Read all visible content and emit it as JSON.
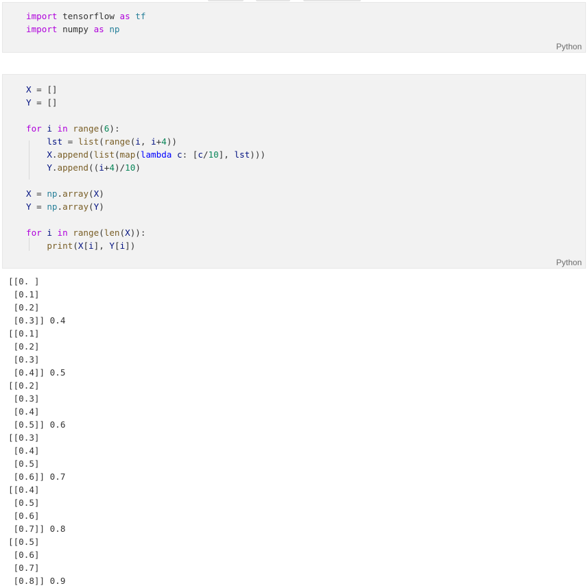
{
  "cells": [
    {
      "language": "Python",
      "lines": [
        [
          {
            "t": "import",
            "c": "kw"
          },
          {
            "t": " tensorflow ",
            "c": "plain"
          },
          {
            "t": "as",
            "c": "kw"
          },
          {
            "t": " tf",
            "c": "mod"
          }
        ],
        [
          {
            "t": "import",
            "c": "kw"
          },
          {
            "t": " numpy ",
            "c": "plain"
          },
          {
            "t": "as",
            "c": "kw"
          },
          {
            "t": " np",
            "c": "mod"
          }
        ]
      ]
    },
    {
      "language": "Python",
      "lines": [
        [
          {
            "t": "X",
            "c": "var"
          },
          {
            "t": " = []",
            "c": "plain"
          }
        ],
        [
          {
            "t": "Y",
            "c": "var"
          },
          {
            "t": " = []",
            "c": "plain"
          }
        ],
        [],
        [
          {
            "t": "for",
            "c": "kw"
          },
          {
            "t": " i ",
            "c": "var"
          },
          {
            "t": "in",
            "c": "kw"
          },
          {
            "t": " range",
            "c": "fn"
          },
          {
            "t": "(",
            "c": "plain"
          },
          {
            "t": "6",
            "c": "num"
          },
          {
            "t": "):",
            "c": "plain"
          }
        ],
        [
          {
            "t": "    lst",
            "c": "var"
          },
          {
            "t": " = ",
            "c": "plain"
          },
          {
            "t": "list",
            "c": "fn"
          },
          {
            "t": "(",
            "c": "plain"
          },
          {
            "t": "range",
            "c": "fn"
          },
          {
            "t": "(",
            "c": "plain"
          },
          {
            "t": "i",
            "c": "var"
          },
          {
            "t": ", ",
            "c": "plain"
          },
          {
            "t": "i",
            "c": "var"
          },
          {
            "t": "+",
            "c": "plain"
          },
          {
            "t": "4",
            "c": "num"
          },
          {
            "t": "))",
            "c": "plain"
          }
        ],
        [
          {
            "t": "    X",
            "c": "var"
          },
          {
            "t": ".",
            "c": "plain"
          },
          {
            "t": "append",
            "c": "fn"
          },
          {
            "t": "(",
            "c": "plain"
          },
          {
            "t": "list",
            "c": "fn"
          },
          {
            "t": "(",
            "c": "plain"
          },
          {
            "t": "map",
            "c": "fn"
          },
          {
            "t": "(",
            "c": "plain"
          },
          {
            "t": "lambda",
            "c": "kw2"
          },
          {
            "t": " c",
            "c": "var"
          },
          {
            "t": ": [",
            "c": "plain"
          },
          {
            "t": "c",
            "c": "var"
          },
          {
            "t": "/",
            "c": "plain"
          },
          {
            "t": "10",
            "c": "num"
          },
          {
            "t": "], ",
            "c": "plain"
          },
          {
            "t": "lst",
            "c": "var"
          },
          {
            "t": ")))",
            "c": "plain"
          }
        ],
        [
          {
            "t": "    Y",
            "c": "var"
          },
          {
            "t": ".",
            "c": "plain"
          },
          {
            "t": "append",
            "c": "fn"
          },
          {
            "t": "((",
            "c": "plain"
          },
          {
            "t": "i",
            "c": "var"
          },
          {
            "t": "+",
            "c": "plain"
          },
          {
            "t": "4",
            "c": "num"
          },
          {
            "t": ")/",
            "c": "plain"
          },
          {
            "t": "10",
            "c": "num"
          },
          {
            "t": ")",
            "c": "plain"
          }
        ],
        [],
        [
          {
            "t": "X",
            "c": "var"
          },
          {
            "t": " = ",
            "c": "plain"
          },
          {
            "t": "np",
            "c": "mod"
          },
          {
            "t": ".",
            "c": "plain"
          },
          {
            "t": "array",
            "c": "fn"
          },
          {
            "t": "(",
            "c": "plain"
          },
          {
            "t": "X",
            "c": "var"
          },
          {
            "t": ")",
            "c": "plain"
          }
        ],
        [
          {
            "t": "Y",
            "c": "var"
          },
          {
            "t": " = ",
            "c": "plain"
          },
          {
            "t": "np",
            "c": "mod"
          },
          {
            "t": ".",
            "c": "plain"
          },
          {
            "t": "array",
            "c": "fn"
          },
          {
            "t": "(",
            "c": "plain"
          },
          {
            "t": "Y",
            "c": "var"
          },
          {
            "t": ")",
            "c": "plain"
          }
        ],
        [],
        [
          {
            "t": "for",
            "c": "kw"
          },
          {
            "t": " i ",
            "c": "var"
          },
          {
            "t": "in",
            "c": "kw"
          },
          {
            "t": " range",
            "c": "fn"
          },
          {
            "t": "(",
            "c": "plain"
          },
          {
            "t": "len",
            "c": "fn"
          },
          {
            "t": "(",
            "c": "plain"
          },
          {
            "t": "X",
            "c": "var"
          },
          {
            "t": ")):",
            "c": "plain"
          }
        ],
        [
          {
            "t": "    print",
            "c": "fn"
          },
          {
            "t": "(",
            "c": "plain"
          },
          {
            "t": "X",
            "c": "var"
          },
          {
            "t": "[",
            "c": "plain"
          },
          {
            "t": "i",
            "c": "var"
          },
          {
            "t": "], ",
            "c": "plain"
          },
          {
            "t": "Y",
            "c": "var"
          },
          {
            "t": "[",
            "c": "plain"
          },
          {
            "t": "i",
            "c": "var"
          },
          {
            "t": "])",
            "c": "plain"
          }
        ]
      ]
    }
  ],
  "output_lines": [
    "[[0. ]",
    " [0.1]",
    " [0.2]",
    " [0.3]] 0.4",
    "[[0.1]",
    " [0.2]",
    " [0.3]",
    " [0.4]] 0.5",
    "[[0.2]",
    " [0.3]",
    " [0.4]",
    " [0.5]] 0.6",
    "[[0.3]",
    " [0.4]",
    " [0.5]",
    " [0.6]] 0.7",
    "[[0.4]",
    " [0.5]",
    " [0.6]",
    " [0.7]] 0.8",
    "[[0.5]",
    " [0.6]",
    " [0.7]",
    " [0.8]] 0.9"
  ],
  "colors": {
    "keyword": "#af00db",
    "keyword_lambda": "#0000ff",
    "function": "#795e26",
    "variable": "#001080",
    "number": "#098658",
    "module": "#267f99",
    "text": "#333333",
    "cell_background": "#f2f2f2"
  }
}
